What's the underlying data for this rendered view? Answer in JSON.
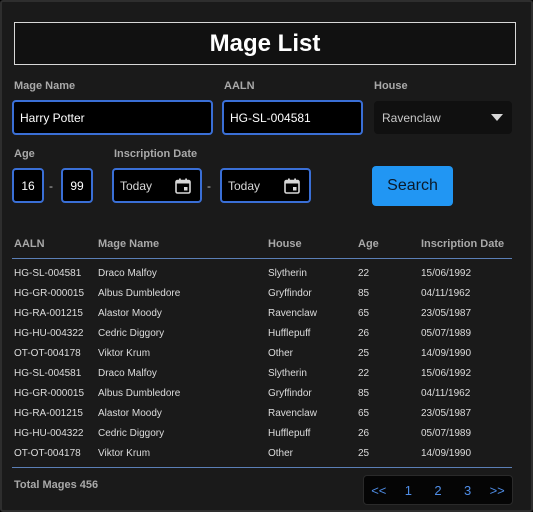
{
  "title": "Mage List",
  "form": {
    "name_label": "Mage Name",
    "name_value": "Harry Potter",
    "aaln_label": "AALN",
    "aaln_value": "HG-SL-004581",
    "house_label": "House",
    "house_value": "Ravenclaw",
    "age_label": "Age",
    "age_min": "16",
    "age_max": "99",
    "age_separator": "-",
    "date_label": "Inscription Date",
    "date_from": "Today",
    "date_to": "Today",
    "date_separator": "-",
    "search_label": "Search"
  },
  "table": {
    "headers": [
      "AALN",
      "Mage Name",
      "House",
      "Age",
      "Inscription Date"
    ],
    "rows": [
      [
        "HG-SL-004581",
        "Draco Malfoy",
        "Slytherin",
        "22",
        "15/06/1992"
      ],
      [
        "HG-GR-000015",
        "Albus Dumbledore",
        "Gryffindor",
        "85",
        "04/11/1962"
      ],
      [
        "HG-RA-001215",
        "Alastor Moody",
        "Ravenclaw",
        "65",
        "23/05/1987"
      ],
      [
        "HG-HU-004322",
        "Cedric Diggory",
        "Hufflepuff",
        "26",
        "05/07/1989"
      ],
      [
        "OT-OT-004178",
        "Viktor Krum",
        "Other",
        "25",
        "14/09/1990"
      ],
      [
        "HG-SL-004581",
        "Draco Malfoy",
        "Slytherin",
        "22",
        "15/06/1992"
      ],
      [
        "HG-GR-000015",
        "Albus Dumbledore",
        "Gryffindor",
        "85",
        "04/11/1962"
      ],
      [
        "HG-RA-001215",
        "Alastor Moody",
        "Ravenclaw",
        "65",
        "23/05/1987"
      ],
      [
        "HG-HU-004322",
        "Cedric Diggory",
        "Hufflepuff",
        "26",
        "05/07/1989"
      ],
      [
        "OT-OT-004178",
        "Viktor Krum",
        "Other",
        "25",
        "14/09/1990"
      ]
    ]
  },
  "footer": {
    "total_text": "Total Mages 456",
    "pagination": [
      "<<",
      "1",
      "2",
      "3",
      ">>"
    ]
  },
  "colors": {
    "accent": "#2196f3",
    "field_border": "#3a6fd6",
    "page_link": "#4f8de6",
    "background": "#1a1a1a"
  },
  "icons": {
    "date_picker": "calendar-icon",
    "select_caret": "caret-down-icon"
  }
}
